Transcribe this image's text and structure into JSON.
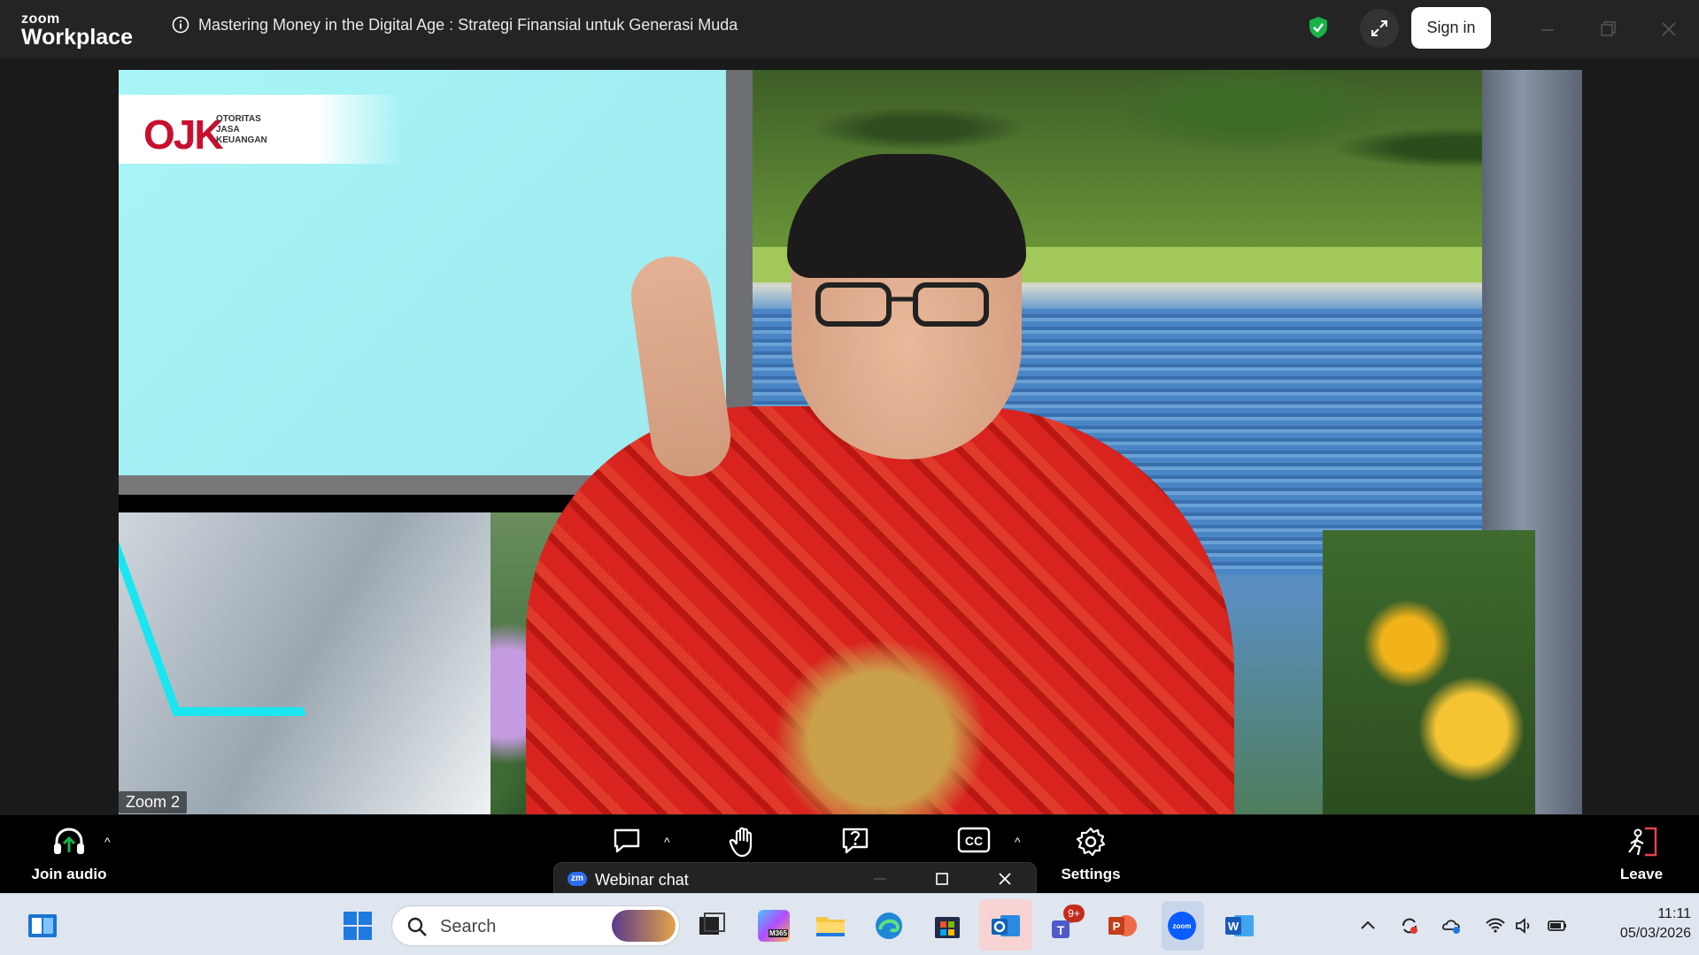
{
  "titlebar": {
    "brand_line1": "zoom",
    "brand_line2": "Workplace",
    "meeting_title": "Mastering Money in the Digital Age : Strategi Finansial untuk Generasi Muda",
    "sign_in_label": "Sign in",
    "icons": [
      "info-icon",
      "shield-icon",
      "expand-icon",
      "minimize-icon",
      "restore-icon",
      "close-icon"
    ]
  },
  "video": {
    "participant_name": "Zoom 2",
    "logo_mark": "OJK",
    "logo_text_1": "OTORITAS",
    "logo_text_2": "JASA",
    "logo_text_3": "KEUANGAN"
  },
  "toolbar": {
    "join_audio_label": "Join audio",
    "settings_label": "Settings",
    "leave_label": "Leave",
    "chat_popup_label": "Webinar chat",
    "chat_popup_badge": "zm"
  },
  "taskbar": {
    "search_placeholder": "Search",
    "teams_badge": "9+",
    "time": "11:11",
    "date": "05/03/2026",
    "m365_label": "M365"
  },
  "colors": {
    "accent": "#2d6cf0",
    "shield": "#19b34a",
    "ojk_red": "#c8102e"
  }
}
